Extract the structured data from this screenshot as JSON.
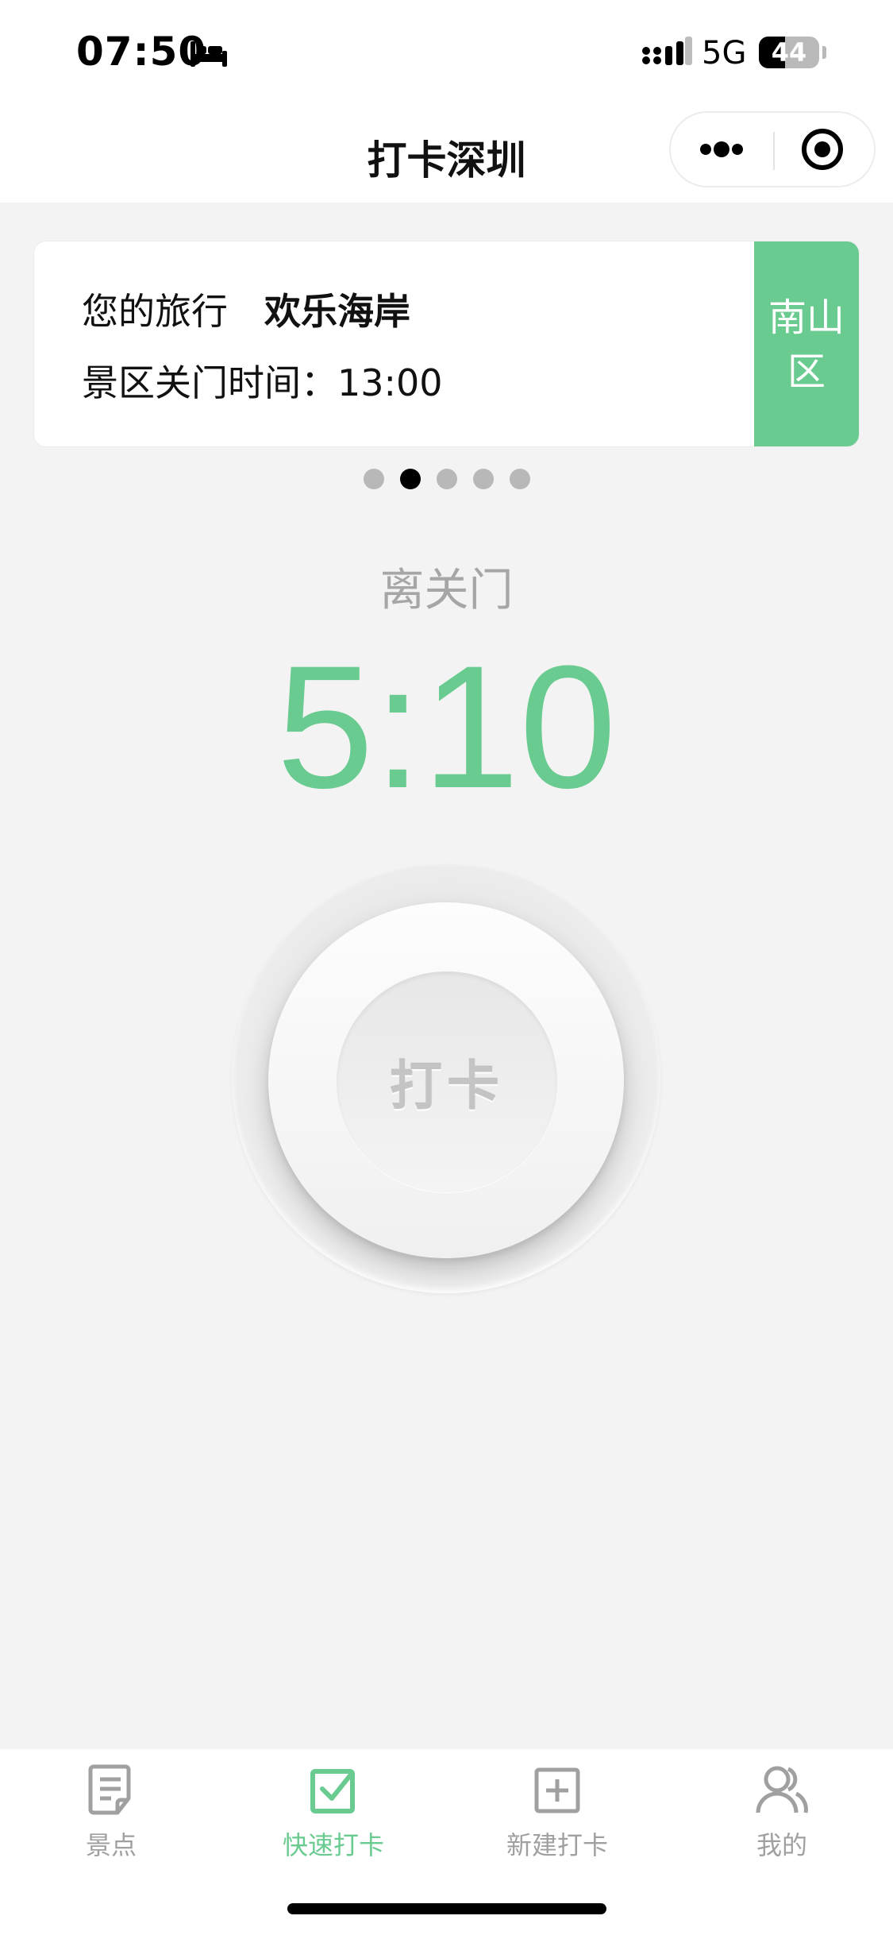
{
  "status_bar": {
    "time": "07:50",
    "sleep_icon": "bed-icon",
    "signal_icon": "cellular-signal-icon",
    "network": "5G",
    "battery_level": "44",
    "battery_fraction": 0.44
  },
  "nav_bar": {
    "title": "打卡深圳",
    "more_icon": "more-dots-icon",
    "close_icon": "target-circle-icon"
  },
  "trip_card": {
    "trip_label": "您的旅行",
    "trip_name": "欢乐海岸",
    "closing_label": "景区关门时间：",
    "closing_time": "13:00",
    "district": "南山区"
  },
  "carousel": {
    "count": 5,
    "active_index": 1
  },
  "countdown": {
    "label": "离关门",
    "value": "5:10"
  },
  "checkin_button": {
    "label": "打卡"
  },
  "tab_bar": {
    "items": [
      {
        "label": "景点",
        "icon": "document-edit-icon",
        "active": false
      },
      {
        "label": "快速打卡",
        "icon": "checkbox-icon",
        "active": true
      },
      {
        "label": "新建打卡",
        "icon": "plus-square-icon",
        "active": false
      },
      {
        "label": "我的",
        "icon": "users-icon",
        "active": false
      }
    ]
  },
  "colors": {
    "accent": "#69cb8f",
    "inactive": "#a0a0a0",
    "background": "#f3f3f3"
  }
}
